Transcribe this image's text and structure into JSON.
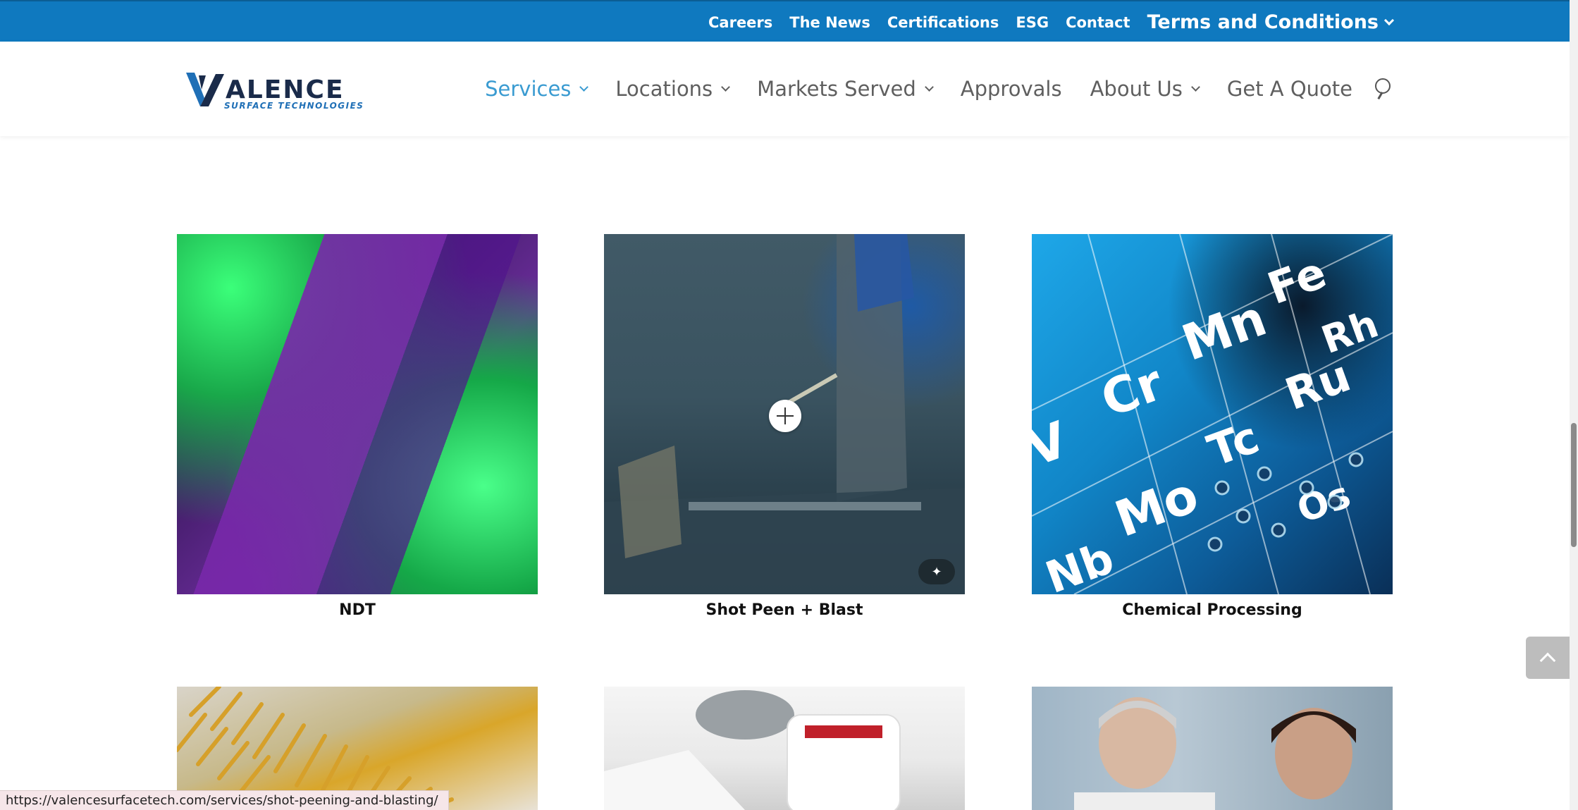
{
  "topbar": {
    "links": [
      "Careers",
      "The News",
      "Certifications",
      "ESG",
      "Contact"
    ],
    "terms": "Terms and Conditions"
  },
  "logo": {
    "brand": "VALENCE",
    "tagline": "SURFACE TECHNOLOGIES",
    "accent": "#1f6fb6",
    "dark": "#1a2b4a"
  },
  "nav": {
    "items": [
      {
        "label": "Services",
        "dropdown": true,
        "active": true
      },
      {
        "label": "Locations",
        "dropdown": true
      },
      {
        "label": "Markets Served",
        "dropdown": true
      },
      {
        "label": "Approvals",
        "dropdown": false
      },
      {
        "label": "About Us",
        "dropdown": true
      },
      {
        "label": "Get A Quote",
        "dropdown": false
      }
    ]
  },
  "cards": [
    {
      "title": "NDT"
    },
    {
      "title": "Shot Peen + Blast"
    },
    {
      "title": "Chemical Processing"
    }
  ],
  "status": {
    "url": "https://valencesurfacetech.com/services/shot-peening-and-blasting/"
  },
  "colors": {
    "topbar": "#0f79bf",
    "nav_active": "#3a9bd1",
    "nav_text": "#5f5f5f"
  }
}
